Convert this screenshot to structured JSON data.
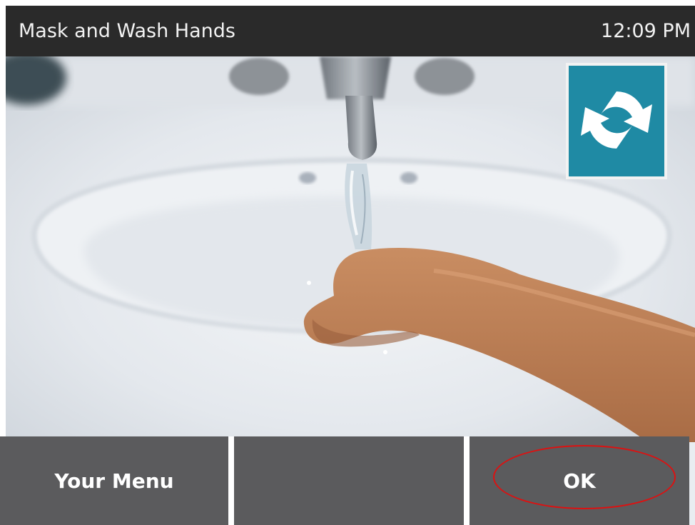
{
  "header": {
    "title": "Mask and Wash Hands",
    "time": "12:09 PM"
  },
  "media": {
    "refresh_icon": "refresh-icon",
    "accent_color": "#1f8aa4"
  },
  "footer": {
    "buttons": [
      {
        "label": "Your Menu"
      },
      {
        "label": ""
      },
      {
        "label": "OK"
      }
    ]
  },
  "annotation": {
    "highlight_color": "#d11111"
  }
}
